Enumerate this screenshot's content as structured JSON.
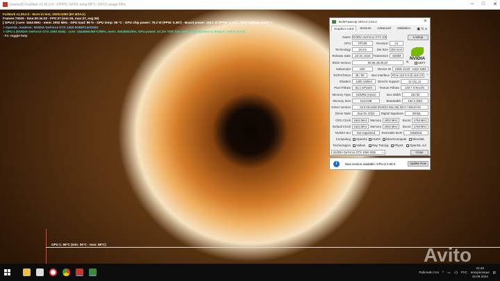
{
  "window_title": "Geeks3D FurMark v1.35.0.0 - 37FPS, GPU1 temp:68°C, GPU1 usage:99%",
  "hud": [
    "FurMark v1.35.0.0 - Burn-in test, 1920x1080 (8X MSAA)",
    "Frames:73025 - time:00:34:02 - FPS:37 (min:26, max:37, avg:36)",
    "[ GPU-Z ] core: 1544 MHz - mem: 2002 MHz - GPU load: 99 % - GPU temp: 68 °C - GPU chip power: 79.2 W (PPW: 0.467) - Board power: 119.1 W (PPW: 0.311) - GPU voltage: 0.937 V",
    "> OpenGL renderer: NVIDIA GeForce GTX 1060 6GB/PCIe/SSE2",
    "> GPU 1 (NVIDIA GeForce GTX 1060 6GB) - core: 1544MHz/68°C/99%, mem: 4004MHz/6%, GPU power: 67.2% TDP, fan: 63%, limits:[power:0, temp:0, volt:0, OV:0]",
    "- F1: toggle help"
  ],
  "graph_label": "GPU 1: 68°C (min: 36°C - max: 68°C)",
  "gpuz": {
    "title": "TechPowerUp GPU-Z 2.54.0",
    "tabs": [
      "Graphics Card",
      "Sensors",
      "Advanced",
      "Validation"
    ],
    "lookup": "Lookup",
    "close": "Close",
    "name": "NVIDIA GeForce GTX 1060 6GB",
    "gpu": "GP106",
    "revision": "A1",
    "technology": "16 nm",
    "die_size": "200 mm²",
    "release_date": "Jul 19, 2016",
    "transistors": "4400M",
    "bios": "86.06.45.00.20",
    "uefi": "UEFI",
    "subvendor": "MSI",
    "device_id": "10DE 1C03 - 1462 3283",
    "rops_tmus": "48 / 80",
    "bus_interface": "PCIe x16 3.0 @ x16 3.0",
    "shaders": "1280 Unified",
    "directx": "12 (12_1)",
    "pixel_fillrate": "84.4 GPixel/s",
    "texture_fillrate": "140.7 GTexel/s",
    "memory_type": "GDDR5 (Hynix)",
    "bus_width": "192 bit",
    "memory_size": "6144 MB",
    "bandwidth": "192.2 GB/s",
    "driver_version": "32.0.15.6109 (NVIDIA 561.09) DCH / Win10 64",
    "driver_date": "Sep 05, 2024",
    "digital_signature": "WHQL",
    "gpu_clock": "1544 MHz",
    "memory_clock": "2002 MHz",
    "boost": "1759 MHz",
    "default_clock": "1544 MHz",
    "default_memory": "2002 MHz",
    "default_boost": "1759 MHz",
    "sli": "Not supported",
    "resizable_bar": "Disabled",
    "labels": {
      "name": "Name",
      "gpu": "GPU",
      "revision": "Revision",
      "technology": "Technology",
      "die_size": "Die Size",
      "release_date": "Release Date",
      "transistors": "Transistors",
      "bios": "BIOS Version",
      "subvendor": "Subvendor",
      "device_id": "Device ID",
      "rops": "ROPs/TMUs",
      "bus": "Bus Interface",
      "shaders": "Shaders",
      "directx": "DirectX Support",
      "pixel": "Pixel Fillrate",
      "texture": "Texture Fillrate",
      "memtype": "Memory Type",
      "buswidth": "Bus Width",
      "memsize": "Memory Size",
      "bandwidth": "Bandwidth",
      "driver": "Driver Version",
      "driverdate": "Driver Date",
      "digsig": "Digital Signature",
      "gpuclock": "GPU Clock",
      "memory": "Memory",
      "boost": "Boost",
      "defclock": "Default Clock",
      "sli": "NVIDIA SLI",
      "rebar": "Resizable BAR",
      "computing": "Computing",
      "technologies": "Technologies"
    },
    "computing": [
      {
        "l": "OpenCL",
        "c": true
      },
      {
        "l": "CUDA",
        "c": true
      },
      {
        "l": "DirectCompute",
        "c": true
      },
      {
        "l": "DirectML",
        "c": false
      }
    ],
    "technologies": [
      {
        "l": "Vulkan",
        "c": true
      },
      {
        "l": "Ray Tracing",
        "c": true
      },
      {
        "l": "PhysX",
        "c": true
      },
      {
        "l": "OpenGL 4.6",
        "c": true
      }
    ],
    "selected_gpu": "NVIDIA GeForce GTX 1060 6GB",
    "nvidia": "NVIDIA"
  },
  "notification": {
    "text": "New version available: GPU-Z 2.60.0",
    "button": "Update Now"
  },
  "taskbar": {
    "desktop": "Рабочий стол",
    "lang": "РУС",
    "time": "22:46",
    "day": "воскресенье",
    "date": "15.09.2024"
  },
  "watermark": "Avito"
}
